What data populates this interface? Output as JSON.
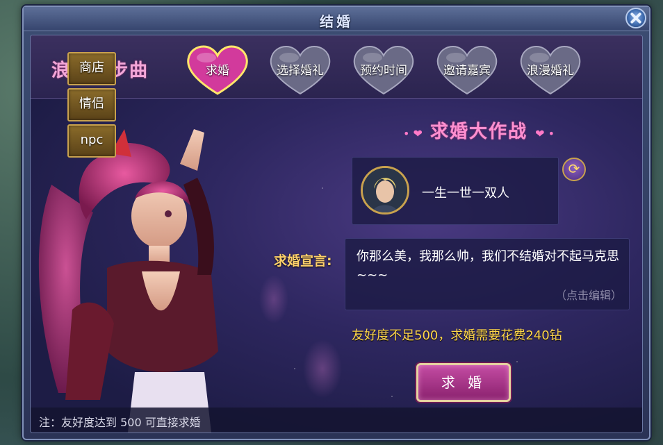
{
  "window": {
    "title": "结婚"
  },
  "logo": {
    "text": "浪漫三步曲"
  },
  "tabs": [
    {
      "label": "求婚",
      "active": true
    },
    {
      "label": "选择婚礼",
      "active": false
    },
    {
      "label": "预约时间",
      "active": false
    },
    {
      "label": "邀请嘉宾",
      "active": false
    },
    {
      "label": "浪漫婚礼",
      "active": false
    }
  ],
  "side_menu": [
    {
      "label": "商店"
    },
    {
      "label": "情侣"
    },
    {
      "label": "npc"
    }
  ],
  "section": {
    "title": "求婚大作战"
  },
  "partner": {
    "name": "一生一世一双人"
  },
  "vow": {
    "label": "求婚宣言:",
    "text": "你那么美，我那么帅，我们不结婚对不起马克思~~~",
    "edit_hint": "（点击编辑）"
  },
  "notice": "友好度不足500，求婚需要花费240钻",
  "propose_button": "求 婚",
  "footer_note": "注：友好度达到 500 可直接求婚",
  "colors": {
    "accent_pink": "#ff8fd0",
    "gold": "#ffd64a",
    "panel_bg": "#221f4c"
  }
}
